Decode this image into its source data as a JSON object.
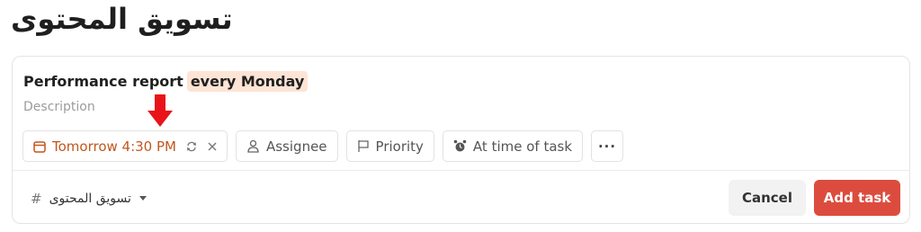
{
  "page": {
    "title": "تسويق المحتوى"
  },
  "task": {
    "name": "Performance report",
    "recurrence_highlight": "every Monday",
    "description_placeholder": "Description"
  },
  "chips": {
    "due_date": "Tomorrow 4:30 PM",
    "assignee": "Assignee",
    "priority": "Priority",
    "reminder": "At time of task",
    "more": "···"
  },
  "footer": {
    "project": "تسويق المحتوى",
    "project_prefix": "#",
    "cancel_label": "Cancel",
    "add_label": "Add task"
  },
  "colors": {
    "accent": "#dc4c3e",
    "date_text": "#c0571f",
    "highlight_bg": "#fde4d5",
    "arrow": "#e8141a"
  },
  "icons": {
    "date": "calendar-icon",
    "recur": "repeat-icon",
    "clear": "close-icon",
    "assignee": "person-icon",
    "priority": "flag-icon",
    "reminder": "alarm-icon",
    "project_dropdown": "caret-down-icon"
  }
}
